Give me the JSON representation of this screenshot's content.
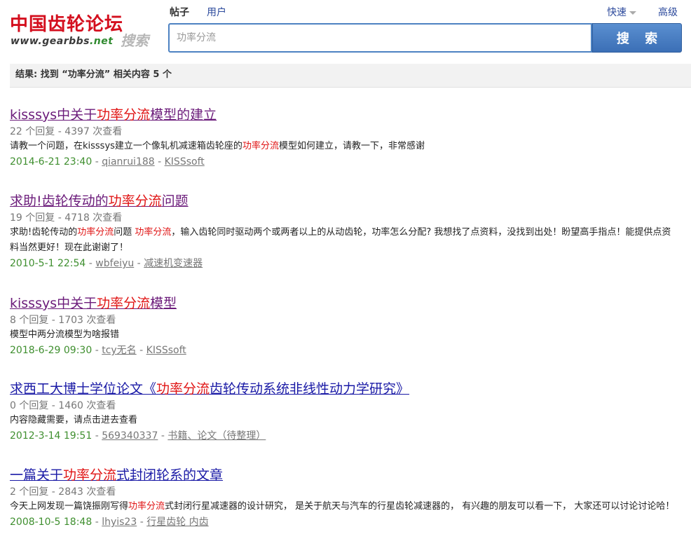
{
  "logo": {
    "title_cn": "中国齿轮论坛",
    "url_main": "www.gearbbs",
    "url_tld": ".net",
    "search_word": "搜索"
  },
  "tabs": {
    "posts": "帖子",
    "users": "用户"
  },
  "header": {
    "quick": "快速",
    "advanced": "高级"
  },
  "search": {
    "value": "",
    "placeholder": "功率分流",
    "button": "搜 索"
  },
  "summary": {
    "text": "结果: 找到 “功率分流” 相关内容 5 个"
  },
  "results": [
    {
      "title_before": "kisssys中关于",
      "title_hl": "功率分流",
      "title_after": "模型的建立",
      "stats": "22 个回复 - 4397 次查看",
      "desc_before": "请教一个问题，在kisssys建立一个像轧机减速箱齿轮座的",
      "desc_hl": "功率分流",
      "desc_after": "模型如何建立，请教一下，非常感谢",
      "date": "2014-6-21 23:40",
      "author": "qianrui188",
      "forum": "KISSsoft"
    },
    {
      "title_before": "求助!齿轮传动的",
      "title_hl": "功率分流",
      "title_after": "问题",
      "stats": "19 个回复 - 4718 次查看",
      "desc_before": "求助!齿轮传动的",
      "desc_hl": "功率分流",
      "desc_mid": "问题 ",
      "desc_hl2": "功率分流",
      "desc_after": "，输入齿轮同时驱动两个或两者以上的从动齿轮，功率怎么分配? 我想找了点资料，没找到出处！盼望高手指点！能提供点资料当然更好！现在此谢谢了！",
      "date": "2010-5-1 22:54",
      "author": "wbfeiyu",
      "forum": "减速机变速器"
    },
    {
      "title_before": "kisssys中关于",
      "title_hl": "功率分流",
      "title_after": "模型",
      "stats": "8 个回复 - 1703 次查看",
      "desc_before": "模型中两分流模型为啥报错",
      "date": "2018-6-29 09:30",
      "author": "tcy无名",
      "forum": "KISSsoft"
    },
    {
      "title_before": "求西工大博士学位论文《",
      "title_hl": "功率分流",
      "title_after": "齿轮传动系统非线性动力学研究》",
      "stats": "0 个回复 - 1460 次查看",
      "desc_before": "内容隐藏需要，请点击进去查看",
      "date": "2012-3-14 19:51",
      "author": "569340337",
      "forum": "书籍、论文（待整理）"
    },
    {
      "title_before": "一篇关于",
      "title_hl": "功率分流",
      "title_after": "式封闭轮系的文章",
      "stats": "2 个回复 - 2843 次查看",
      "desc_before": "今天上网发现一篇饶振刚写得",
      "desc_hl": "功率分流",
      "desc_after": "式封闭行星减速器的设计研究， 是关于航天与汽车的行星齿轮减速器的， 有兴趣的朋友可以看一下， 大家还可以讨论讨论哈！",
      "date": "2008-10-5 18:48",
      "author": "lhyis23",
      "forum": "行星齿轮 内齿"
    }
  ],
  "colors": {
    "logo_red": "#d40f1e",
    "link_blue": "#2c4a9c",
    "highlight_red": "#e01414",
    "date_green": "#3f8f2f",
    "button_blue": "#4a7fc4"
  }
}
